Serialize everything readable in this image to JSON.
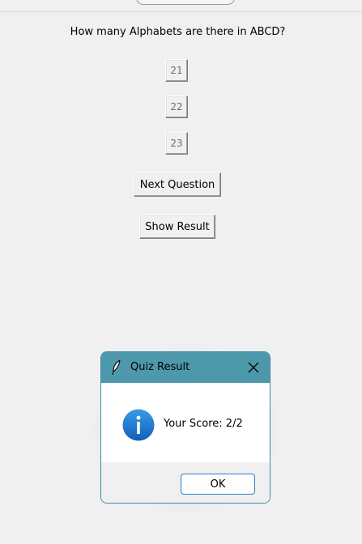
{
  "quiz": {
    "question": "How many Alphabets are there in ABCD?",
    "options": [
      "21",
      "22",
      "23"
    ],
    "next_label": "Next Question",
    "result_label": "Show Result"
  },
  "dialog": {
    "title": "Quiz Result",
    "message": "Your Score: 2/2",
    "ok_label": "OK",
    "title_icon": "feather-icon",
    "message_icon": "info-icon"
  },
  "colors": {
    "titlebar": "#4d99ab",
    "info_icon": "#1e78d2",
    "ok_border": "#2a7fd0"
  }
}
